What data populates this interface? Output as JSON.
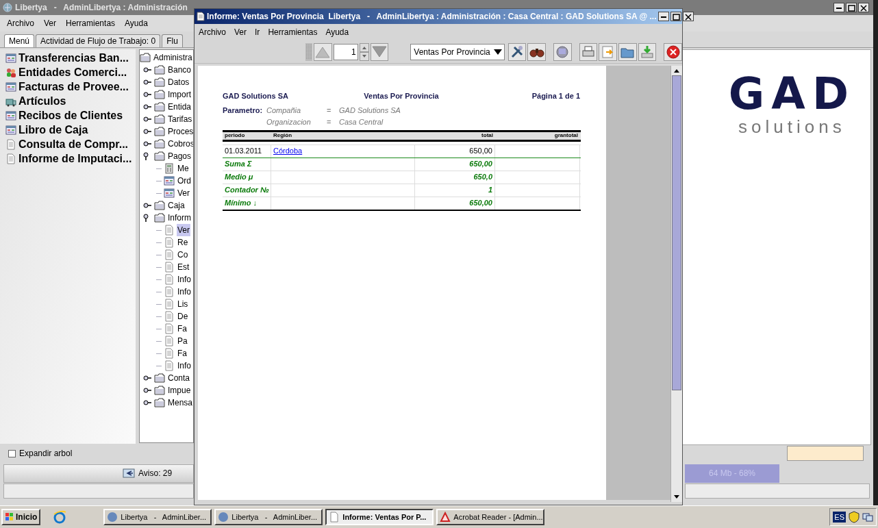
{
  "main_window": {
    "title": "Libertya   -   AdminLibertya : Administración",
    "menu": [
      "Archivo",
      "Ver",
      "Herramientas",
      "Ayuda"
    ],
    "tabs": [
      {
        "label": "Menú",
        "selected": true
      },
      {
        "label": "Actividad de Flujo de Trabajo: 0",
        "selected": false
      },
      {
        "label": "Flu",
        "selected": false
      }
    ],
    "favorites": [
      {
        "label": "Transferencias Ban...",
        "kind": "window"
      },
      {
        "label": "Entidades Comerci...",
        "kind": "partner"
      },
      {
        "label": "Facturas de Provee...",
        "kind": "window"
      },
      {
        "label": "Artículos",
        "kind": "product"
      },
      {
        "label": "Recibos de Clientes",
        "kind": "window"
      },
      {
        "label": "Libro de Caja",
        "kind": "window"
      },
      {
        "label": "Consulta de Compr...",
        "kind": "report"
      },
      {
        "label": "Informe de Imputaci...",
        "kind": "report"
      }
    ],
    "tree": {
      "label": "Administra",
      "kind": "folder",
      "selected": false,
      "children": [
        {
          "label": "Banco",
          "kind": "folder",
          "expanded": false,
          "selected": false
        },
        {
          "label": "Datos",
          "kind": "folder",
          "expanded": false,
          "selected": false
        },
        {
          "label": "Import",
          "kind": "folder",
          "expanded": false,
          "selected": false
        },
        {
          "label": "Entida",
          "kind": "folder",
          "expanded": false,
          "selected": false
        },
        {
          "label": "Tarifas",
          "kind": "folder",
          "expanded": false,
          "selected": false
        },
        {
          "label": "Proces",
          "kind": "folder",
          "expanded": false,
          "selected": false
        },
        {
          "label": "Cobros",
          "kind": "folder",
          "expanded": false,
          "selected": false
        },
        {
          "label": "Pagos",
          "kind": "folder",
          "expanded": true,
          "selected": false,
          "children": [
            {
              "label": "Me",
              "kind": "process",
              "selected": false
            },
            {
              "label": "Ord",
              "kind": "window",
              "selected": false
            },
            {
              "label": "Ver",
              "kind": "window",
              "selected": false
            }
          ]
        },
        {
          "label": "Caja",
          "kind": "folder",
          "expanded": false,
          "selected": false
        },
        {
          "label": "Inform",
          "kind": "folder",
          "expanded": true,
          "selected": false,
          "children": [
            {
              "label": "Ver",
              "kind": "report",
              "selected": true
            },
            {
              "label": "Re",
              "kind": "report",
              "selected": false
            },
            {
              "label": "Co",
              "kind": "report",
              "selected": false
            },
            {
              "label": "Est",
              "kind": "report",
              "selected": false
            },
            {
              "label": "Info",
              "kind": "report",
              "selected": false
            },
            {
              "label": "Info",
              "kind": "report",
              "selected": false
            },
            {
              "label": "Lis",
              "kind": "report",
              "selected": false
            },
            {
              "label": "De",
              "kind": "report",
              "selected": false
            },
            {
              "label": "Fa",
              "kind": "report",
              "selected": false
            },
            {
              "label": "Pa",
              "kind": "report",
              "selected": false
            },
            {
              "label": "Fa",
              "kind": "report",
              "selected": false
            },
            {
              "label": "Info",
              "kind": "report",
              "selected": false
            }
          ]
        },
        {
          "label": "Conta",
          "kind": "folder",
          "expanded": false,
          "selected": false
        },
        {
          "label": "Impue",
          "kind": "folder",
          "expanded": false,
          "selected": false
        },
        {
          "label": "Mensa",
          "kind": "folder",
          "expanded": false,
          "selected": false
        }
      ]
    },
    "logo": {
      "name": "GAD",
      "tagline": "solutions"
    },
    "expand_tree": {
      "label": "Expandir arbol",
      "checked": false
    },
    "status": {
      "notice": "Aviso: 29",
      "memory": "64 Mb - 68%"
    }
  },
  "report_window": {
    "title": "Informe: Ventas Por Provincia  Libertya   -   AdminLibertya : Administración : Casa Central : GAD Solutions SA @ ...",
    "menu": [
      "Archivo",
      "Ver",
      "Ir",
      "Herramientas",
      "Ayuda"
    ],
    "page_field": "1",
    "report_select": "Ventas Por Provincia",
    "report": {
      "company": "GAD Solutions SA",
      "title": "Ventas Por Provincia",
      "page": "Página 1 de 1",
      "parameter_label": "Parametro:",
      "parameters": [
        {
          "name": "Compañia",
          "op": "=",
          "value": "GAD Solutions SA"
        },
        {
          "name": "Organizacion",
          "op": "=",
          "value": "Casa Central"
        }
      ],
      "columns": [
        "periodo",
        "Región",
        "total",
        "grantotal"
      ],
      "rows": [
        {
          "kind": "data",
          "period": "01.03.2011",
          "region": "Córdoba",
          "total": "650,00"
        },
        {
          "kind": "summary",
          "period": "Suma Σ",
          "total": "650,00"
        },
        {
          "kind": "summary",
          "period": "Medio μ",
          "total": "650,0"
        },
        {
          "kind": "summary",
          "period": "Contador №",
          "total": "1"
        },
        {
          "kind": "summary",
          "period": "Mínimo ↓",
          "total": "650,00"
        }
      ]
    }
  },
  "taskbar": {
    "start": "Inicio",
    "tasks": [
      {
        "label": "Libertya   -   AdminLiber...",
        "selected": false
      },
      {
        "label": "Libertya   -   AdminLiber...",
        "selected": false
      },
      {
        "label": "Informe: Ventas Por P...",
        "selected": true
      },
      {
        "label": "Acrobat Reader - [Admin...",
        "selected": false
      }
    ],
    "language": "ES"
  }
}
